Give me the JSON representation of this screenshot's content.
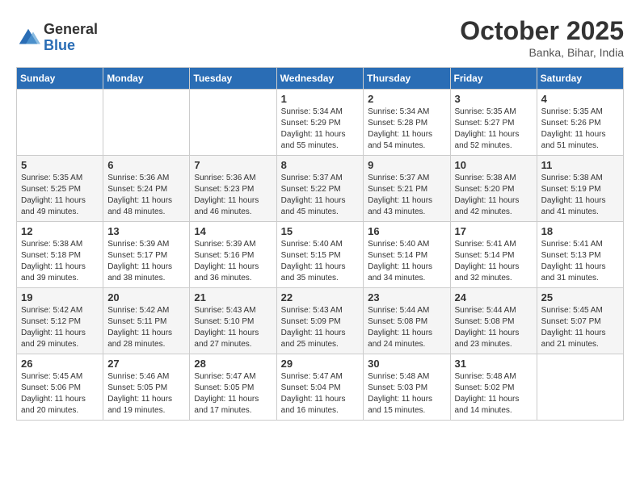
{
  "logo": {
    "general": "General",
    "blue": "Blue"
  },
  "header": {
    "month": "October 2025",
    "location": "Banka, Bihar, India"
  },
  "weekdays": [
    "Sunday",
    "Monday",
    "Tuesday",
    "Wednesday",
    "Thursday",
    "Friday",
    "Saturday"
  ],
  "weeks": [
    [
      {
        "day": "",
        "sunrise": "",
        "sunset": "",
        "daylight": ""
      },
      {
        "day": "",
        "sunrise": "",
        "sunset": "",
        "daylight": ""
      },
      {
        "day": "",
        "sunrise": "",
        "sunset": "",
        "daylight": ""
      },
      {
        "day": "1",
        "sunrise": "Sunrise: 5:34 AM",
        "sunset": "Sunset: 5:29 PM",
        "daylight": "Daylight: 11 hours and 55 minutes."
      },
      {
        "day": "2",
        "sunrise": "Sunrise: 5:34 AM",
        "sunset": "Sunset: 5:28 PM",
        "daylight": "Daylight: 11 hours and 54 minutes."
      },
      {
        "day": "3",
        "sunrise": "Sunrise: 5:35 AM",
        "sunset": "Sunset: 5:27 PM",
        "daylight": "Daylight: 11 hours and 52 minutes."
      },
      {
        "day": "4",
        "sunrise": "Sunrise: 5:35 AM",
        "sunset": "Sunset: 5:26 PM",
        "daylight": "Daylight: 11 hours and 51 minutes."
      }
    ],
    [
      {
        "day": "5",
        "sunrise": "Sunrise: 5:35 AM",
        "sunset": "Sunset: 5:25 PM",
        "daylight": "Daylight: 11 hours and 49 minutes."
      },
      {
        "day": "6",
        "sunrise": "Sunrise: 5:36 AM",
        "sunset": "Sunset: 5:24 PM",
        "daylight": "Daylight: 11 hours and 48 minutes."
      },
      {
        "day": "7",
        "sunrise": "Sunrise: 5:36 AM",
        "sunset": "Sunset: 5:23 PM",
        "daylight": "Daylight: 11 hours and 46 minutes."
      },
      {
        "day": "8",
        "sunrise": "Sunrise: 5:37 AM",
        "sunset": "Sunset: 5:22 PM",
        "daylight": "Daylight: 11 hours and 45 minutes."
      },
      {
        "day": "9",
        "sunrise": "Sunrise: 5:37 AM",
        "sunset": "Sunset: 5:21 PM",
        "daylight": "Daylight: 11 hours and 43 minutes."
      },
      {
        "day": "10",
        "sunrise": "Sunrise: 5:38 AM",
        "sunset": "Sunset: 5:20 PM",
        "daylight": "Daylight: 11 hours and 42 minutes."
      },
      {
        "day": "11",
        "sunrise": "Sunrise: 5:38 AM",
        "sunset": "Sunset: 5:19 PM",
        "daylight": "Daylight: 11 hours and 41 minutes."
      }
    ],
    [
      {
        "day": "12",
        "sunrise": "Sunrise: 5:38 AM",
        "sunset": "Sunset: 5:18 PM",
        "daylight": "Daylight: 11 hours and 39 minutes."
      },
      {
        "day": "13",
        "sunrise": "Sunrise: 5:39 AM",
        "sunset": "Sunset: 5:17 PM",
        "daylight": "Daylight: 11 hours and 38 minutes."
      },
      {
        "day": "14",
        "sunrise": "Sunrise: 5:39 AM",
        "sunset": "Sunset: 5:16 PM",
        "daylight": "Daylight: 11 hours and 36 minutes."
      },
      {
        "day": "15",
        "sunrise": "Sunrise: 5:40 AM",
        "sunset": "Sunset: 5:15 PM",
        "daylight": "Daylight: 11 hours and 35 minutes."
      },
      {
        "day": "16",
        "sunrise": "Sunrise: 5:40 AM",
        "sunset": "Sunset: 5:14 PM",
        "daylight": "Daylight: 11 hours and 34 minutes."
      },
      {
        "day": "17",
        "sunrise": "Sunrise: 5:41 AM",
        "sunset": "Sunset: 5:14 PM",
        "daylight": "Daylight: 11 hours and 32 minutes."
      },
      {
        "day": "18",
        "sunrise": "Sunrise: 5:41 AM",
        "sunset": "Sunset: 5:13 PM",
        "daylight": "Daylight: 11 hours and 31 minutes."
      }
    ],
    [
      {
        "day": "19",
        "sunrise": "Sunrise: 5:42 AM",
        "sunset": "Sunset: 5:12 PM",
        "daylight": "Daylight: 11 hours and 29 minutes."
      },
      {
        "day": "20",
        "sunrise": "Sunrise: 5:42 AM",
        "sunset": "Sunset: 5:11 PM",
        "daylight": "Daylight: 11 hours and 28 minutes."
      },
      {
        "day": "21",
        "sunrise": "Sunrise: 5:43 AM",
        "sunset": "Sunset: 5:10 PM",
        "daylight": "Daylight: 11 hours and 27 minutes."
      },
      {
        "day": "22",
        "sunrise": "Sunrise: 5:43 AM",
        "sunset": "Sunset: 5:09 PM",
        "daylight": "Daylight: 11 hours and 25 minutes."
      },
      {
        "day": "23",
        "sunrise": "Sunrise: 5:44 AM",
        "sunset": "Sunset: 5:08 PM",
        "daylight": "Daylight: 11 hours and 24 minutes."
      },
      {
        "day": "24",
        "sunrise": "Sunrise: 5:44 AM",
        "sunset": "Sunset: 5:08 PM",
        "daylight": "Daylight: 11 hours and 23 minutes."
      },
      {
        "day": "25",
        "sunrise": "Sunrise: 5:45 AM",
        "sunset": "Sunset: 5:07 PM",
        "daylight": "Daylight: 11 hours and 21 minutes."
      }
    ],
    [
      {
        "day": "26",
        "sunrise": "Sunrise: 5:45 AM",
        "sunset": "Sunset: 5:06 PM",
        "daylight": "Daylight: 11 hours and 20 minutes."
      },
      {
        "day": "27",
        "sunrise": "Sunrise: 5:46 AM",
        "sunset": "Sunset: 5:05 PM",
        "daylight": "Daylight: 11 hours and 19 minutes."
      },
      {
        "day": "28",
        "sunrise": "Sunrise: 5:47 AM",
        "sunset": "Sunset: 5:05 PM",
        "daylight": "Daylight: 11 hours and 17 minutes."
      },
      {
        "day": "29",
        "sunrise": "Sunrise: 5:47 AM",
        "sunset": "Sunset: 5:04 PM",
        "daylight": "Daylight: 11 hours and 16 minutes."
      },
      {
        "day": "30",
        "sunrise": "Sunrise: 5:48 AM",
        "sunset": "Sunset: 5:03 PM",
        "daylight": "Daylight: 11 hours and 15 minutes."
      },
      {
        "day": "31",
        "sunrise": "Sunrise: 5:48 AM",
        "sunset": "Sunset: 5:02 PM",
        "daylight": "Daylight: 11 hours and 14 minutes."
      },
      {
        "day": "",
        "sunrise": "",
        "sunset": "",
        "daylight": ""
      }
    ]
  ]
}
